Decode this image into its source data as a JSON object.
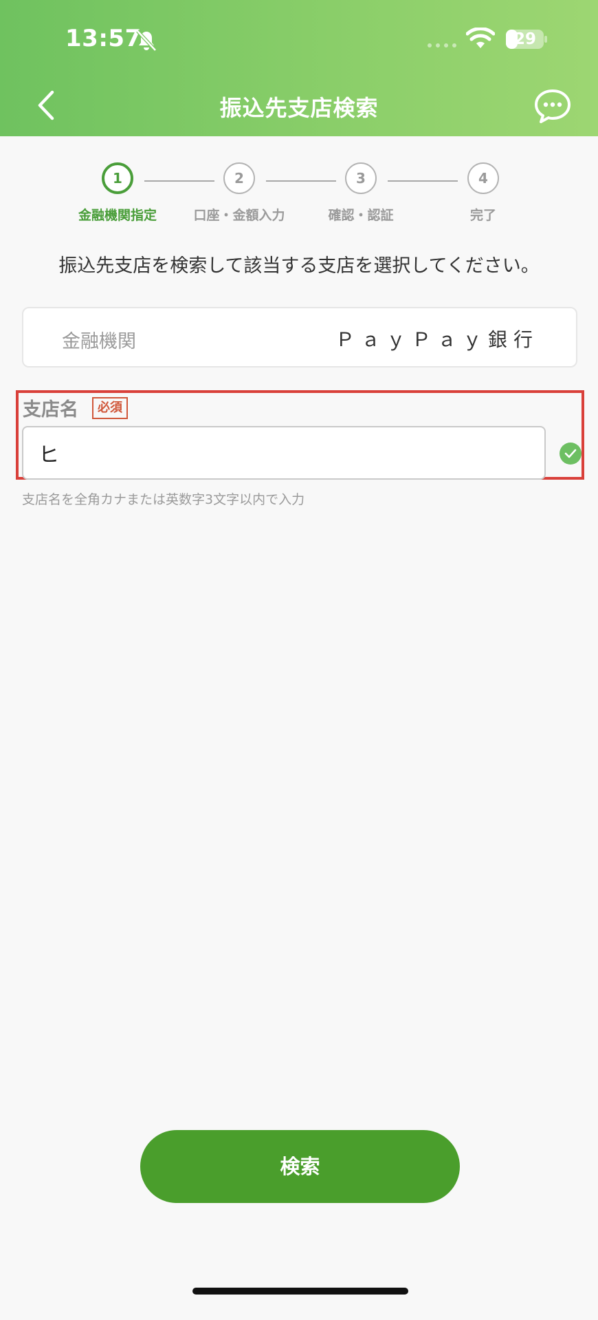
{
  "status_bar": {
    "time": "13:57",
    "battery": "29",
    "icons": [
      "bell-slash-icon",
      "cellular-icon",
      "wifi-icon",
      "battery-icon"
    ]
  },
  "nav": {
    "title": "振込先支店検索",
    "back_icon": "chevron-left-icon",
    "chat_icon": "chat-bubble-icon"
  },
  "stepper": {
    "steps": [
      {
        "number": "1",
        "label": "金融機関指定",
        "active": true
      },
      {
        "number": "2",
        "label": "口座・金額入力",
        "active": false
      },
      {
        "number": "3",
        "label": "確認・認証",
        "active": false
      },
      {
        "number": "4",
        "label": "完了",
        "active": false
      }
    ]
  },
  "instruction": "振込先支店を検索して該当する支店を選択してください。",
  "bank": {
    "label": "金融機関",
    "value": "ＰａｙＰａｙ銀行"
  },
  "branch": {
    "label": "支店名",
    "required_badge": "必須",
    "input_value": "ヒ",
    "hint": "支店名を全角カナまたは英数字3文字以内で入力"
  },
  "actions": {
    "search_label": "検索"
  },
  "colors": {
    "header_green": "#7cc963",
    "primary_green": "#4a9e2c",
    "highlight_red": "#d9403a",
    "required_red": "#d0573a"
  }
}
